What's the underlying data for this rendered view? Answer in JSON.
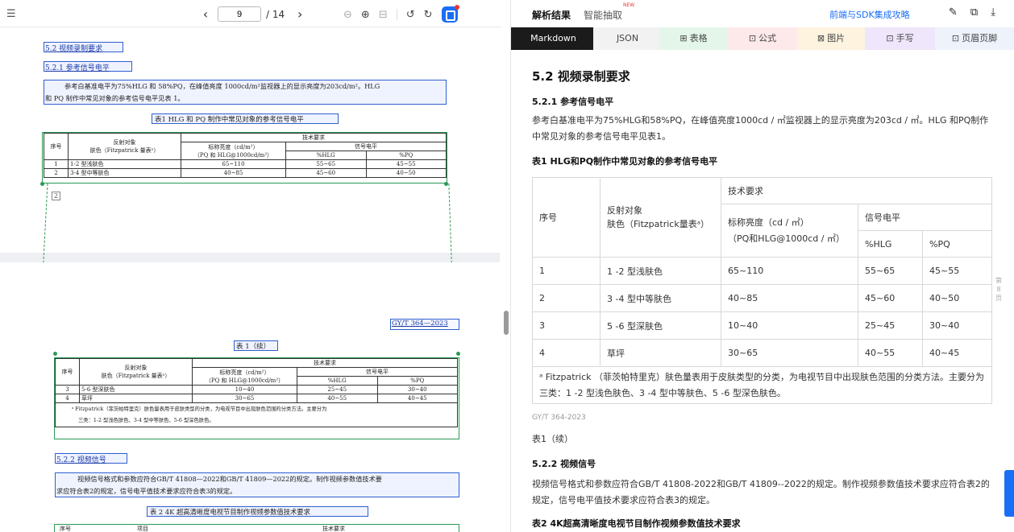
{
  "left_toolbar": {
    "page_current": "9",
    "page_total": "/ 14"
  },
  "doc_page1": {
    "h_52": "5.2  视频录制要求",
    "h_521": "5.2.1  参考信号电平",
    "para_line1": "参考白基准电平为75%HLG 和 58%PQ，在峰值亮度 1000cd/m²监视器上的显示亮度为203cd/m²。HLG",
    "para_line2": "和 PQ 制作中常见对象的参考信号电平见表 1。",
    "table_caption": "表1  HLG 和 PQ 制作中常见对象的参考信号电平",
    "th_no": "序号",
    "th_obj1": "反射对象",
    "th_obj2": "肤色（Fitzpatrick 量表ᵃ）",
    "th_tech": "技术要求",
    "th_lum1": "标称亮度（cd/m²）",
    "th_lum2": "（PQ 和 HLG@1000cd/m²）",
    "th_sig": "信号电平",
    "th_hlg": "%HLG",
    "th_pq": "%PQ",
    "rows": [
      [
        "1",
        "1-2 型浅肤色",
        "65~110",
        "55~65",
        "45~55"
      ],
      [
        "2",
        "3-4 型中等肤色",
        "40~85",
        "45~60",
        "40~50"
      ]
    ],
    "footnote_marker": "2"
  },
  "doc_page2": {
    "std_no": "GY/T 364—2023",
    "cont_caption": "表 1（续）",
    "rows": [
      [
        "3",
        "5-6 型深肤色",
        "10~40",
        "25~45",
        "30~40"
      ],
      [
        "4",
        "草坪",
        "30~65",
        "40~55",
        "40~45"
      ]
    ],
    "note1": "ᵃ Fitzpatrick（菲茨帕特里克）肤色量表用于皮肤类型的分类，为电视节目中出现肤色范围的分类方法。主要分为",
    "note2": "三类：1-2 型浅色肤色、3-4 型中等肤色、5-6 型深色肤色。",
    "h_522": "5.2.2  视频信号",
    "p522_1": "视频信号格式和参数应符合GB/T 41808—2022和GB/T 41809—2022的规定。制作视频参数值技术要",
    "p522_2": "求应符合表2的规定，信号电平值技术要求应符合表3的规定。",
    "table2_caption": "表 2  4K 超高清晰度电视节目制作视频参数值技术要求",
    "t2_h1": "序号",
    "t2_h2": "项目",
    "t2_h3": "技术要求"
  },
  "right_header": {
    "title": "解析结果",
    "smart": "智能抽取",
    "new_badge": "NEW",
    "sdk_link": "前端与SDK集成攻略"
  },
  "tabs": [
    "Markdown",
    "JSON",
    "表格",
    "公式",
    "图片",
    "手写",
    "页眉页脚"
  ],
  "tab_icons": [
    "",
    "",
    "⊞",
    "⊡",
    "⊠",
    "⊡",
    "⊡"
  ],
  "tab_colors": [
    "#1b1b1b",
    "#f2f2f2",
    "#e4f6ea",
    "#fde8ea",
    "#fdf3df",
    "#efe6fb",
    "#edf2fb"
  ],
  "md": {
    "h2": "5.2 视频录制要求",
    "h3_1": "5.2.1 参考信号电平",
    "para1": "参考白基准电平为75%HLG和58%PQ，在峰值亮度1000cd / ㎡监视器上的显示亮度为203cd / ㎡。HLG 和PQ制作中常见对象的参考信号电平见表1。",
    "caption1": "表1 HLG和PQ制作中常见对象的参考信号电平",
    "th_no": "序号",
    "th_obj": "反射对象\n肤色（Fitzpatrick量表ᵃ）",
    "th_tech": "技术要求",
    "th_lum": "标称亮度（cd / ㎡）\n（PQ和HLG@1000cd / ㎡）",
    "th_sig": "信号电平",
    "th_hlg": "%HLG",
    "th_pq": "%PQ",
    "rows": [
      [
        "1",
        "1 -2 型浅肤色",
        "65~110",
        "55~65",
        "45~55"
      ],
      [
        "2",
        "3 -4 型中等肤色",
        "40~85",
        "45~60",
        "40~50"
      ],
      [
        "3",
        "5 -6 型深肤色",
        "10~40",
        "25~45",
        "30~40"
      ],
      [
        "4",
        "草坪",
        "30~65",
        "40~55",
        "40~45"
      ]
    ],
    "note": "ᵃ Fitzpatrick （菲茨帕特里克）肤色量表用于皮肤类型的分类，为电视节目中出现肤色范围的分类方法。主要分为三类：1 -2 型浅色肤色、3 -4 型中等肤色、5 -6 型深色肤色。",
    "std": "GY/T 364-2023",
    "cont": "表1（续）",
    "h3_2": "5.2.2 视频信号",
    "para2": "视频信号格式和参数应符合GB/T 41808-2022和GB/T 41809--2022的规定。制作视频参数值技术要求应符合表2的规定，信号电平值技术要求应符合表3的规定。",
    "caption2": "表2 4K超高清晰度电视节目制作视频参数值技术要求"
  },
  "side_label": "第\n8\n页"
}
